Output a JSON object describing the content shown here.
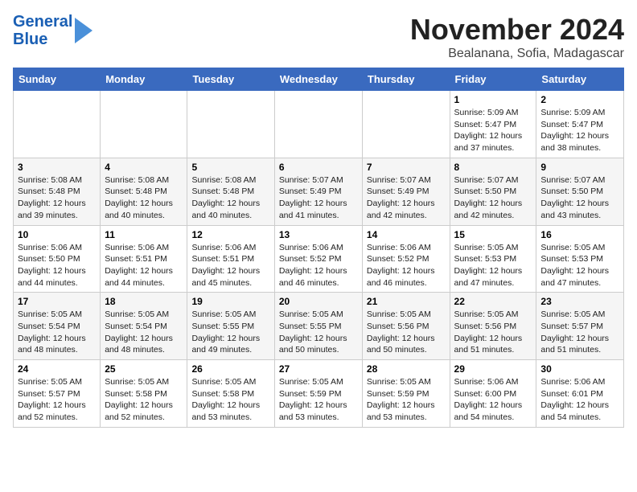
{
  "header": {
    "logo_line1": "General",
    "logo_line2": "Blue",
    "month": "November 2024",
    "location": "Bealanana, Sofia, Madagascar"
  },
  "weekdays": [
    "Sunday",
    "Monday",
    "Tuesday",
    "Wednesday",
    "Thursday",
    "Friday",
    "Saturday"
  ],
  "weeks": [
    [
      {
        "day": "",
        "info": ""
      },
      {
        "day": "",
        "info": ""
      },
      {
        "day": "",
        "info": ""
      },
      {
        "day": "",
        "info": ""
      },
      {
        "day": "",
        "info": ""
      },
      {
        "day": "1",
        "info": "Sunrise: 5:09 AM\nSunset: 5:47 PM\nDaylight: 12 hours\nand 37 minutes."
      },
      {
        "day": "2",
        "info": "Sunrise: 5:09 AM\nSunset: 5:47 PM\nDaylight: 12 hours\nand 38 minutes."
      }
    ],
    [
      {
        "day": "3",
        "info": "Sunrise: 5:08 AM\nSunset: 5:48 PM\nDaylight: 12 hours\nand 39 minutes."
      },
      {
        "day": "4",
        "info": "Sunrise: 5:08 AM\nSunset: 5:48 PM\nDaylight: 12 hours\nand 40 minutes."
      },
      {
        "day": "5",
        "info": "Sunrise: 5:08 AM\nSunset: 5:48 PM\nDaylight: 12 hours\nand 40 minutes."
      },
      {
        "day": "6",
        "info": "Sunrise: 5:07 AM\nSunset: 5:49 PM\nDaylight: 12 hours\nand 41 minutes."
      },
      {
        "day": "7",
        "info": "Sunrise: 5:07 AM\nSunset: 5:49 PM\nDaylight: 12 hours\nand 42 minutes."
      },
      {
        "day": "8",
        "info": "Sunrise: 5:07 AM\nSunset: 5:50 PM\nDaylight: 12 hours\nand 42 minutes."
      },
      {
        "day": "9",
        "info": "Sunrise: 5:07 AM\nSunset: 5:50 PM\nDaylight: 12 hours\nand 43 minutes."
      }
    ],
    [
      {
        "day": "10",
        "info": "Sunrise: 5:06 AM\nSunset: 5:50 PM\nDaylight: 12 hours\nand 44 minutes."
      },
      {
        "day": "11",
        "info": "Sunrise: 5:06 AM\nSunset: 5:51 PM\nDaylight: 12 hours\nand 44 minutes."
      },
      {
        "day": "12",
        "info": "Sunrise: 5:06 AM\nSunset: 5:51 PM\nDaylight: 12 hours\nand 45 minutes."
      },
      {
        "day": "13",
        "info": "Sunrise: 5:06 AM\nSunset: 5:52 PM\nDaylight: 12 hours\nand 46 minutes."
      },
      {
        "day": "14",
        "info": "Sunrise: 5:06 AM\nSunset: 5:52 PM\nDaylight: 12 hours\nand 46 minutes."
      },
      {
        "day": "15",
        "info": "Sunrise: 5:05 AM\nSunset: 5:53 PM\nDaylight: 12 hours\nand 47 minutes."
      },
      {
        "day": "16",
        "info": "Sunrise: 5:05 AM\nSunset: 5:53 PM\nDaylight: 12 hours\nand 47 minutes."
      }
    ],
    [
      {
        "day": "17",
        "info": "Sunrise: 5:05 AM\nSunset: 5:54 PM\nDaylight: 12 hours\nand 48 minutes."
      },
      {
        "day": "18",
        "info": "Sunrise: 5:05 AM\nSunset: 5:54 PM\nDaylight: 12 hours\nand 48 minutes."
      },
      {
        "day": "19",
        "info": "Sunrise: 5:05 AM\nSunset: 5:55 PM\nDaylight: 12 hours\nand 49 minutes."
      },
      {
        "day": "20",
        "info": "Sunrise: 5:05 AM\nSunset: 5:55 PM\nDaylight: 12 hours\nand 50 minutes."
      },
      {
        "day": "21",
        "info": "Sunrise: 5:05 AM\nSunset: 5:56 PM\nDaylight: 12 hours\nand 50 minutes."
      },
      {
        "day": "22",
        "info": "Sunrise: 5:05 AM\nSunset: 5:56 PM\nDaylight: 12 hours\nand 51 minutes."
      },
      {
        "day": "23",
        "info": "Sunrise: 5:05 AM\nSunset: 5:57 PM\nDaylight: 12 hours\nand 51 minutes."
      }
    ],
    [
      {
        "day": "24",
        "info": "Sunrise: 5:05 AM\nSunset: 5:57 PM\nDaylight: 12 hours\nand 52 minutes."
      },
      {
        "day": "25",
        "info": "Sunrise: 5:05 AM\nSunset: 5:58 PM\nDaylight: 12 hours\nand 52 minutes."
      },
      {
        "day": "26",
        "info": "Sunrise: 5:05 AM\nSunset: 5:58 PM\nDaylight: 12 hours\nand 53 minutes."
      },
      {
        "day": "27",
        "info": "Sunrise: 5:05 AM\nSunset: 5:59 PM\nDaylight: 12 hours\nand 53 minutes."
      },
      {
        "day": "28",
        "info": "Sunrise: 5:05 AM\nSunset: 5:59 PM\nDaylight: 12 hours\nand 53 minutes."
      },
      {
        "day": "29",
        "info": "Sunrise: 5:06 AM\nSunset: 6:00 PM\nDaylight: 12 hours\nand 54 minutes."
      },
      {
        "day": "30",
        "info": "Sunrise: 5:06 AM\nSunset: 6:01 PM\nDaylight: 12 hours\nand 54 minutes."
      }
    ]
  ]
}
